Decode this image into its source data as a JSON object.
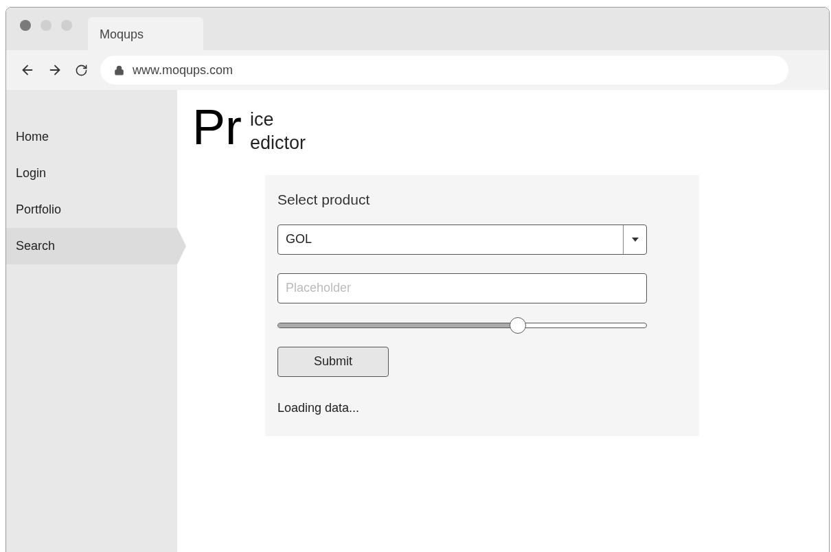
{
  "browser": {
    "tab": {
      "title": "Moqups"
    },
    "address": "www.moqups.com"
  },
  "sidebar": {
    "items": [
      {
        "label": "Home",
        "selected": false
      },
      {
        "label": "Login",
        "selected": false
      },
      {
        "label": "Portfolio",
        "selected": false
      },
      {
        "label": "Search",
        "selected": true
      }
    ]
  },
  "logo": {
    "big": "Pr",
    "top": "ice",
    "bottom": "edictor"
  },
  "form": {
    "title": "Select product",
    "select": {
      "value": "GOL"
    },
    "input": {
      "placeholder": "Placeholder"
    },
    "slider": {
      "level": 0.65
    },
    "button": "Submit",
    "status": "Loading data..."
  }
}
